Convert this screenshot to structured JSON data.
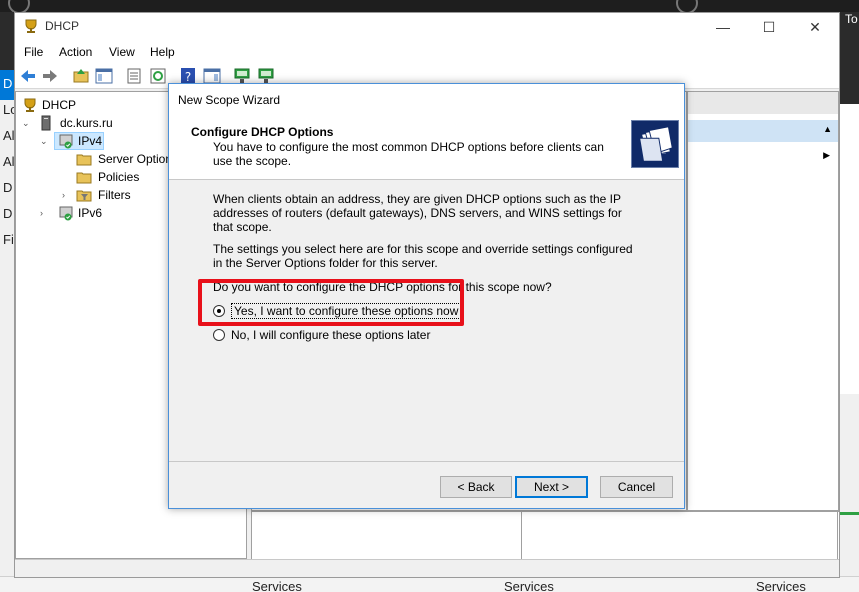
{
  "window": {
    "title": "DHCP",
    "controls": {
      "minimize": "—",
      "maximize": "☐",
      "close": "✕"
    }
  },
  "menu": [
    "File",
    "Action",
    "View",
    "Help"
  ],
  "tree": {
    "root": "DHCP",
    "server": "dc.kurs.ru",
    "ipv4": "IPv4",
    "server_options": "Server Options",
    "policies": "Policies",
    "filters": "Filters",
    "ipv6": "IPv6"
  },
  "background": {
    "left_letters": [
      "D",
      "Lo",
      "Al",
      "Al",
      "D",
      "D",
      "Fi"
    ],
    "right_text": "To",
    "services": [
      "Services",
      "Services",
      "Services"
    ]
  },
  "dialog": {
    "title": "New Scope Wizard",
    "header_title": "Configure DHCP Options",
    "header_subtitle": "You have to configure the most common DHCP options before clients can use the scope.",
    "paragraph1": "When clients obtain an address, they are given DHCP options such as the IP addresses of routers (default gateways), DNS servers, and WINS settings for that scope.",
    "paragraph2": "The settings you select here are for this scope and override settings configured in the Server Options folder for this server.",
    "question": "Do you want to configure the DHCP options for this scope now?",
    "option_yes": "Yes, I want to configure these options now",
    "option_no": "No, I will configure these options later",
    "selected_option": "yes",
    "back_label": "< Back",
    "next_label": "Next >",
    "cancel_label": "Cancel"
  },
  "colors": {
    "accent": "#0078d7",
    "highlight_box": "#e8101a",
    "selection": "#cce8ff"
  }
}
